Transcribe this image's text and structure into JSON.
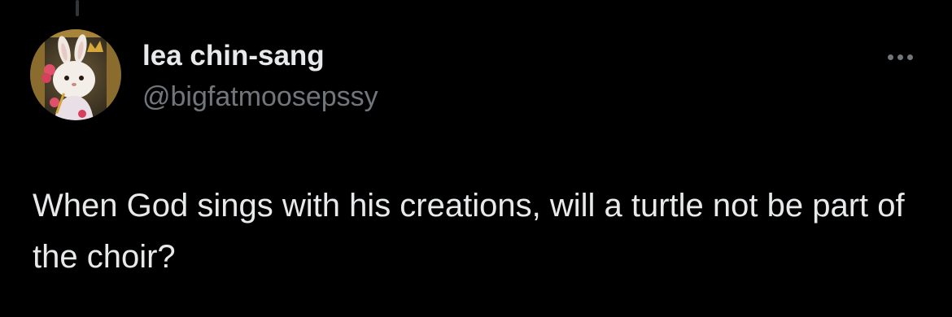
{
  "tweet": {
    "author": {
      "display_name": "lea chin-sang",
      "handle": "@bigfatmoosepssy",
      "avatar_icon": "plush-bunny-avatar"
    },
    "text": "When God sings with his creations, will a turtle not be part of the choir?",
    "more_icon": "more-options-icon"
  },
  "colors": {
    "background": "#000000",
    "primary_text": "#e7e9ea",
    "secondary_text": "#71767b",
    "thread_line": "#333639"
  }
}
